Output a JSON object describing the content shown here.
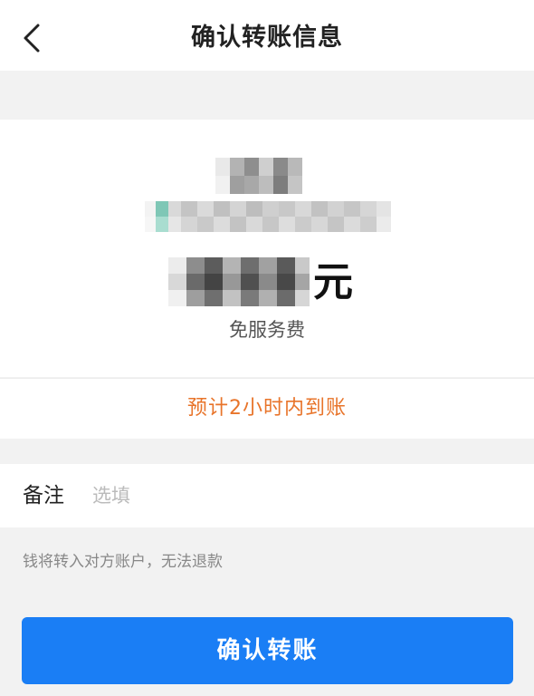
{
  "header": {
    "back_icon": "chevron-left-icon",
    "title": "确认转账信息"
  },
  "transfer": {
    "recipient_name": "",
    "recipient_account": "",
    "amount": "",
    "currency_unit": "元",
    "fee_note": "免服务费",
    "eta": "预计2小时内到账"
  },
  "remark": {
    "label": "备注",
    "placeholder": "选填",
    "value": ""
  },
  "warning": "钱将转入对方账户，无法退款",
  "confirm_button": {
    "label": "确认转账"
  },
  "colors": {
    "accent": "#1a7ef5",
    "eta": "#e8742a",
    "background": "#f2f2f2"
  }
}
